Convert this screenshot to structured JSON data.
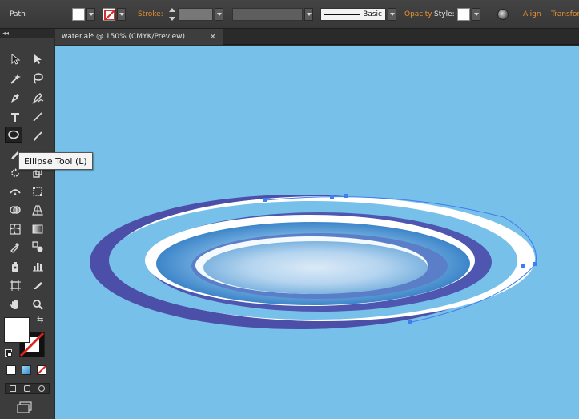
{
  "control_bar": {
    "selection_label": "Path",
    "fill_color": "#ffffff",
    "stroke_label": "Stroke:",
    "brush_label": "Basic",
    "opacity_label": "Opacity",
    "style_label": "Style:",
    "align_label": "Align",
    "transform_label": "Transfor"
  },
  "tools_panel": {
    "collapse_glyph": "◂◂",
    "tools": [
      "selection-tool",
      "direct-selection-tool",
      "magic-wand-tool",
      "lasso-tool",
      "pen-tool",
      "curvature-tool",
      "type-tool",
      "line-segment-tool",
      "ellipse-tool",
      "paintbrush-tool",
      "pencil-tool",
      "eraser-tool",
      "rotate-tool",
      "scale-tool",
      "width-tool",
      "free-transform-tool",
      "shape-builder-tool",
      "perspective-grid-tool",
      "mesh-tool",
      "gradient-tool",
      "eyedropper-tool",
      "blend-tool",
      "symbol-sprayer-tool",
      "column-graph-tool",
      "artboard-tool",
      "slice-tool",
      "hand-tool",
      "zoom-tool"
    ]
  },
  "tooltip": {
    "text": "Ellipse Tool (L)"
  },
  "document": {
    "tab_title": "water.ai* @ 150% (CMYK/Preview)",
    "close_glyph": "✕",
    "canvas_color": "#77c0ea"
  },
  "colors": {
    "accent_orange": "#e8922e",
    "ring_dark": "#4a4fa8",
    "ring_light": "#ffffff",
    "anchor": "#3f7df0"
  }
}
